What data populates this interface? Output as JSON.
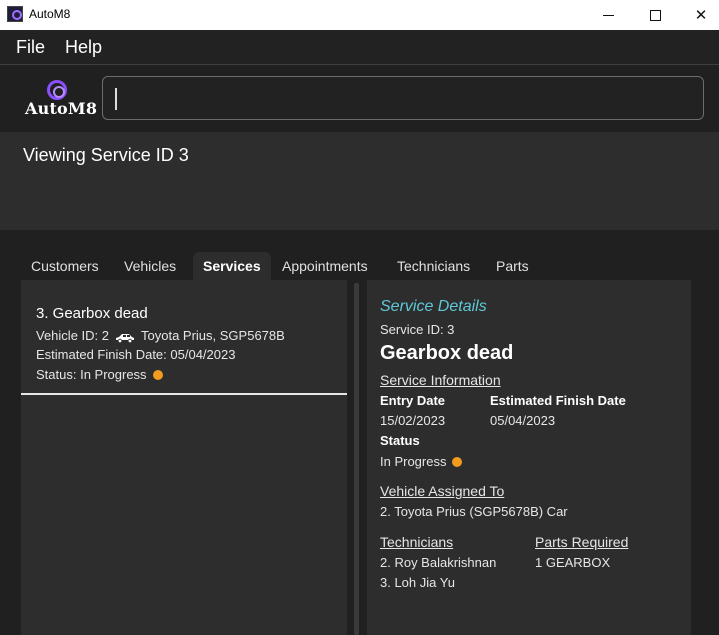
{
  "window": {
    "title": "AutoM8"
  },
  "menu": {
    "file": "File",
    "help": "Help"
  },
  "header": {
    "logo_text": "AutoM8",
    "command_value": ""
  },
  "result": {
    "text": "Viewing Service ID 3"
  },
  "tabs": [
    {
      "label": "Customers"
    },
    {
      "label": "Vehicles"
    },
    {
      "label": "Services",
      "active": true
    },
    {
      "label": "Appointments"
    },
    {
      "label": "Technicians"
    },
    {
      "label": "Parts"
    }
  ],
  "service_list": [
    {
      "title": "3.  Gearbox dead",
      "vehicle_prefix": "Vehicle ID: 2",
      "vehicle_icon": "car-icon",
      "vehicle_desc": "Toyota Prius, SGP5678B",
      "finish": "Estimated Finish Date: 05/04/2023",
      "status": "Status: In Progress",
      "status_color": "#f29b1e"
    }
  ],
  "details": {
    "heading": "Service Details",
    "service_id": "Service ID: 3",
    "name": "Gearbox dead",
    "info_section": "Service Information",
    "entry_label": "Entry Date",
    "entry_value": "15/02/2023",
    "finish_label": "Estimated Finish Date",
    "finish_value": "05/04/2023",
    "status_label": "Status",
    "status_value": "In Progress",
    "status_color": "#f29b1e",
    "vehicle_section": "Vehicle Assigned To",
    "vehicle_value": "2. Toyota Prius (SGP5678B) Car",
    "technicians_section": "Technicians",
    "technicians": [
      "2. Roy Balakrishnan",
      "3. Loh Jia Yu"
    ],
    "parts_section": "Parts Required",
    "parts": [
      "1 GEARBOX"
    ]
  },
  "colors": {
    "accent_heading": "#5ec8d8",
    "logo_purple": "#8a4fff",
    "status_in_progress": "#f29b1e"
  }
}
